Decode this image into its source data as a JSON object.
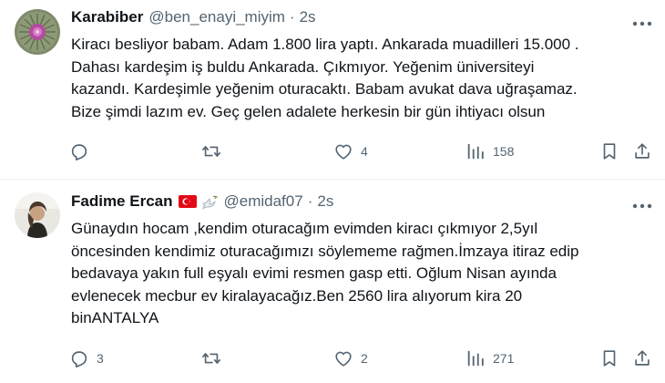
{
  "tweets": [
    {
      "name": "Karabiber",
      "handle": "@ben_enayi_miyim",
      "separator": "·",
      "time": "2s",
      "text_lines": [
        "Kiracı besliyor babam. Adam 1.800 lira yaptı. Ankarada muadilleri 15.000 .",
        "Dahası kardeşim iş buldu Ankarada. Çıkmıyor. Yeğenim üniversiteyi",
        "kazandı. Kardeşimle yeğenim oturacaktı. Babam avukat dava uğraşamaz.",
        "Bize şimdi lazım ev. Geç gelen adalete herkesin bir gün ihtiyacı olsun"
      ],
      "replies": "",
      "reposts": "",
      "likes": "4",
      "views": "158"
    },
    {
      "name": "Fadime Ercan",
      "handle": "@emidaf07",
      "separator": "·",
      "time": "2s",
      "text_lines": [
        "Günaydın hocam ,kendim oturacağım evimden kiracı çıkmıyor 2,5yıl",
        "öncesinden kendimiz oturacağımızı söylememe rağmen.İmzaya itiraz edip",
        "bedavaya yakın full eşyalı evimi resmen gasp etti. Oğlum Nisan ayında",
        "evlenecek mecbur ev kiralayacağız.Ben 2560 lira alıyorum kira 20",
        "binANTALYA"
      ],
      "replies": "3",
      "reposts": "",
      "likes": "2",
      "views": "271"
    }
  ],
  "icons": {
    "more": "more-horizontal-icon",
    "reply": "reply-icon",
    "repost": "repost-icon",
    "like": "heart-icon",
    "views": "views-icon",
    "bookmark": "bookmark-icon",
    "share": "share-icon",
    "flag": "turkey-flag-icon",
    "dove": "dove-icon"
  },
  "colors": {
    "text": "#0f1419",
    "secondary": "#536471",
    "divider": "#eff3f4",
    "flag_red": "#e30a17"
  }
}
